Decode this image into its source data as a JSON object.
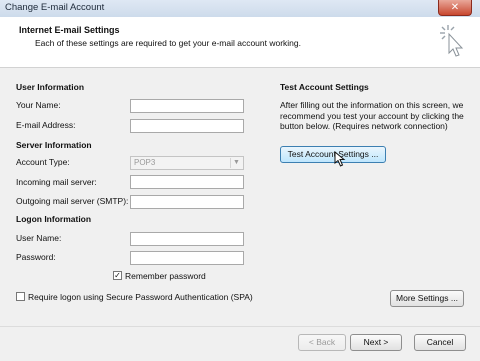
{
  "window": {
    "title": "Change E-mail Account",
    "close_label": "✕"
  },
  "header": {
    "title": "Internet E-mail Settings",
    "subtitle": "Each of these settings are required to get your e-mail account working."
  },
  "user_info": {
    "heading": "User Information",
    "name_label": "Your Name:",
    "name_value": "",
    "email_label": "E-mail Address:",
    "email_value": ""
  },
  "server_info": {
    "heading": "Server Information",
    "account_type_label": "Account Type:",
    "account_type_value": "POP3",
    "incoming_label": "Incoming mail server:",
    "incoming_value": "",
    "outgoing_label": "Outgoing mail server (SMTP):",
    "outgoing_value": ""
  },
  "logon_info": {
    "heading": "Logon Information",
    "username_label": "User Name:",
    "username_value": "",
    "password_label": "Password:",
    "password_value": "",
    "remember_label": "Remember password",
    "remember_checked": true,
    "spa_label": "Require logon using Secure Password Authentication (SPA)",
    "spa_checked": false
  },
  "test_settings": {
    "heading": "Test Account Settings",
    "description": "After filling out the information on this screen, we recommend you test your account by clicking the button below. (Requires network connection)",
    "button_label": "Test Account Settings ..."
  },
  "more_settings_label": "More Settings ...",
  "footer": {
    "back_label": "< Back",
    "next_label": "Next >",
    "cancel_label": "Cancel"
  }
}
